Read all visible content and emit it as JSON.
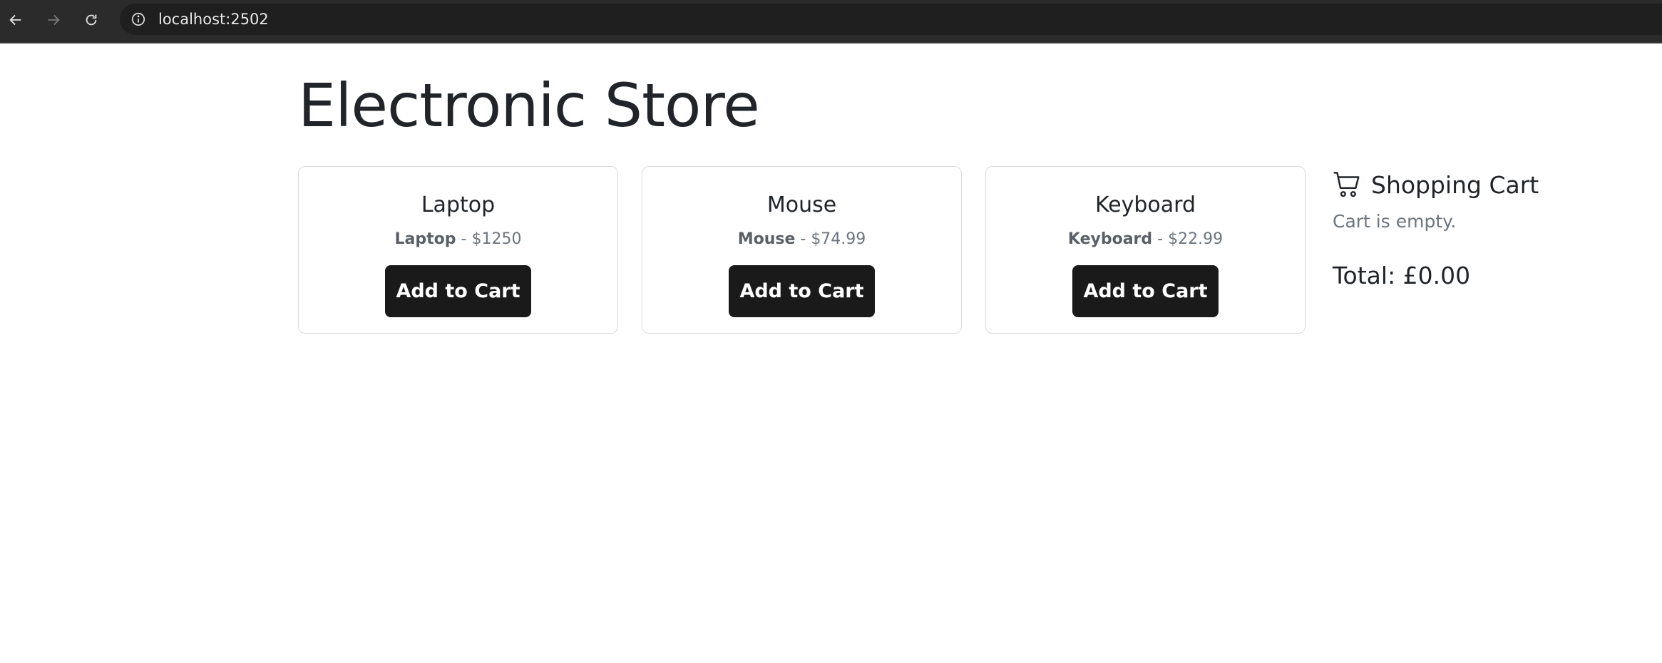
{
  "browser": {
    "url": "localhost:2502"
  },
  "page": {
    "title": "Electronic Store"
  },
  "products": [
    {
      "name": "Laptop",
      "desc_name": "Laptop",
      "separator": " - ",
      "price": "$1250",
      "button_label": "Add to Cart"
    },
    {
      "name": "Mouse",
      "desc_name": "Mouse",
      "separator": " - ",
      "price": "$74.99",
      "button_label": "Add to Cart"
    },
    {
      "name": "Keyboard",
      "desc_name": "Keyboard",
      "separator": " - ",
      "price": "$22.99",
      "button_label": "Add to Cart"
    }
  ],
  "cart": {
    "icon": "cart-icon",
    "title": "Shopping Cart",
    "empty_message": "Cart is empty.",
    "total_label": "Total: £0.00"
  },
  "colors": {
    "button_bg": "#1a1a1a",
    "chrome_bg": "#2b2b2b"
  }
}
